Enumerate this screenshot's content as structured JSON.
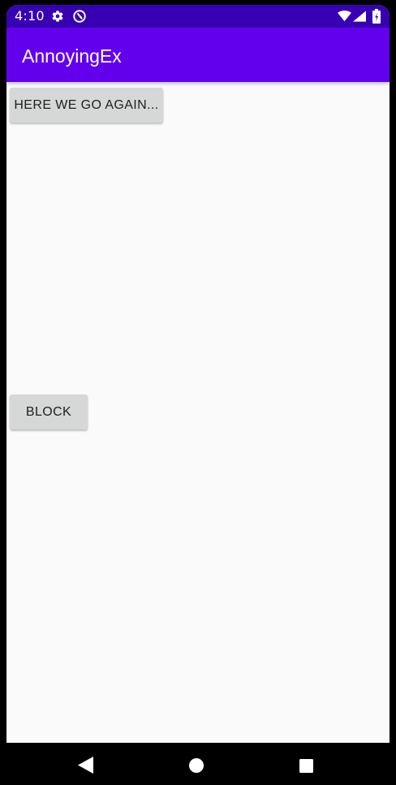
{
  "status_bar": {
    "time": "4:10",
    "icons": [
      "gear-icon",
      "sync-icon",
      "wifi-icon",
      "signal-icon",
      "battery-icon"
    ]
  },
  "app_bar": {
    "title": "AnnoyingEx"
  },
  "main": {
    "again_button_label": "HERE WE GO AGAIN...",
    "block_button_label": "BLOCK"
  },
  "nav_bar": {
    "icons": [
      "back-icon",
      "home-icon",
      "recents-icon"
    ]
  },
  "colors": {
    "status_bar": "#3700B3",
    "app_bar": "#6200EE",
    "background": "#FAFAFA",
    "button": "#D6D7D7"
  }
}
